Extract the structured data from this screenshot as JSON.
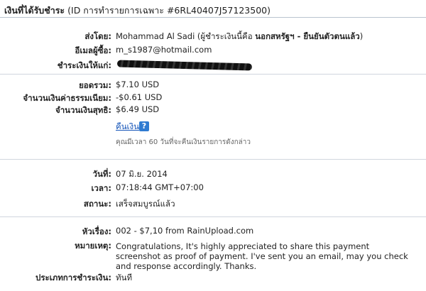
{
  "header": {
    "title_prefix": "เงินที่ได้รับชำระ",
    "title_suffix": "(ID การทำรายการเฉพาะ #6RL40407J57123500)"
  },
  "sender": {
    "label": "ส่งโดย:",
    "name": "Mohammad Al Sadi",
    "note_open": "(ผู้ชำระเงินนี้คือ",
    "note_bold": "นอกสหรัฐฯ - ยืนยันตัวตนแล้ว",
    "note_close": ")"
  },
  "buyer_email": {
    "label": "อีเมลผู้ซื้อ:",
    "value": "m_s1987@hotmail.com"
  },
  "paid_to": {
    "label": "ชำระเงินให้แก่:"
  },
  "amounts": {
    "total_label": "ยอดรวม:",
    "total_value": "$7.10 USD",
    "fee_label": "จำนวนเงินค่าธรรมเนียม:",
    "fee_value": "-$0.61 USD",
    "net_label": "จำนวนเงินสุทธิ:",
    "net_value": "$6.49 USD"
  },
  "refund": {
    "link_label": "คืนเงิน",
    "help_icon": "?",
    "note": "คุณมีเวลา 60 วันที่จะคืนเงินรายการดังกล่าว"
  },
  "details": {
    "date_label": "วันที่:",
    "date_value": "07 มิ.ย. 2014",
    "time_label": "เวลา:",
    "time_value": "07:18:44 GMT+07:00",
    "status_label": "สถานะ:",
    "status_value": "เสร็จสมบูรณ์แล้ว"
  },
  "message": {
    "subject_label": "หัวเรื่อง:",
    "subject_value": "002 - $7,10 from RainUpload.com",
    "note_label": "หมายเหตุ:",
    "note_value": "Congratulations, It's highly appreciated to share this payment screenshot as proof of payment. I've sent you an email, may you check and response accordingly. Thanks.",
    "type_label": "ประเภทการชำระเงิน:",
    "type_value": "ทันที"
  }
}
